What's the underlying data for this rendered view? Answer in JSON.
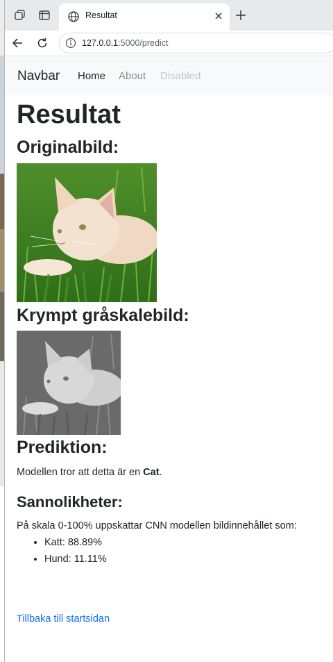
{
  "browser": {
    "tab_title": "Resultat",
    "url_host": "127.0.0.1",
    "url_path": ":5000/predict"
  },
  "navbar": {
    "brand": "Navbar",
    "links": [
      {
        "label": "Home",
        "state": "active"
      },
      {
        "label": "About",
        "state": "normal"
      },
      {
        "label": "Disabled",
        "state": "disabled"
      }
    ]
  },
  "page": {
    "title": "Resultat",
    "original_heading": "Originalbild:",
    "gray_heading": "Krympt gråskalebild:",
    "prediction_heading": "Prediktion:",
    "prediction_prefix": "Modellen tror att detta är en ",
    "prediction_label": "Cat",
    "prediction_suffix": ".",
    "prob_heading": "Sannolikheter:",
    "prob_intro": "På skala 0-100% uppskattar CNN modellen bildinnehållet som:",
    "probabilities": [
      "Katt: 88.89%",
      "Hund: 11.11%"
    ],
    "back_link": "Tillbaka till startsidan"
  },
  "colors": {
    "link": "#0d6efd",
    "navbar_bg": "#f8f9fa",
    "text": "#212529",
    "nav_muted": "#8c8c8c",
    "nav_disabled": "#c3c3c3"
  }
}
